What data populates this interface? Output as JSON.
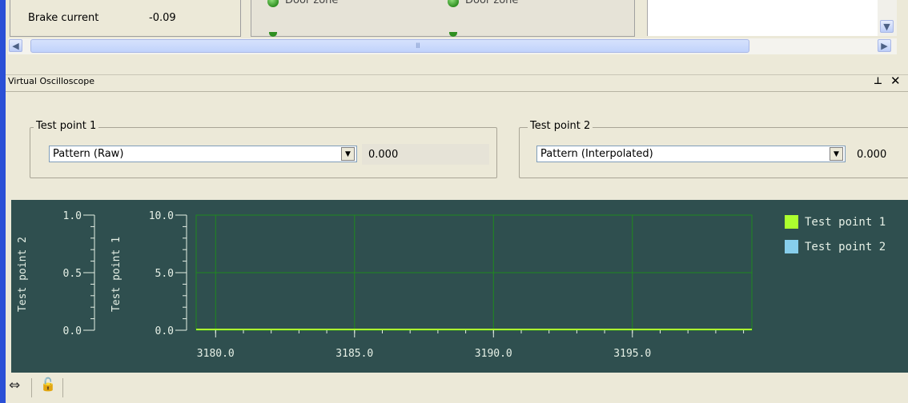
{
  "top": {
    "brake_label": "Brake current",
    "brake_value": "-0.09",
    "door_zone_1": "Door zone",
    "door_zone_2": "Door zone",
    "hscroll_grip": "III"
  },
  "oscilloscope": {
    "title": "Virtual Oscilloscope",
    "pin_icon": "⊥",
    "close_icon": "✕",
    "test_point_1": {
      "label": "Test point 1",
      "selected": "Pattern (Raw)",
      "value": "0.000"
    },
    "test_point_2": {
      "label": "Test point 2",
      "selected": "Pattern (Interpolated)",
      "value": "0.000"
    }
  },
  "colors": {
    "plot_bg": "#2f4f4f",
    "grid": "#1f8a1f",
    "series1": "#adff2f",
    "series2": "#87ceeb"
  },
  "chart_data": {
    "type": "line",
    "x_ticks": [
      "3180.0",
      "3185.0",
      "3190.0",
      "3195.0"
    ],
    "xlim": [
      3179.3,
      3199.3
    ],
    "axes": [
      {
        "title": "Test point 2",
        "ylim": [
          0,
          1
        ],
        "ticks": [
          "1.0",
          "0.5",
          "0.0"
        ]
      },
      {
        "title": "Test point 1",
        "ylim": [
          0,
          10
        ],
        "ticks": [
          "10.0",
          "5.0",
          "0.0"
        ]
      }
    ],
    "series": [
      {
        "name": "Test point 1",
        "x": [
          3179.3,
          3199.3
        ],
        "y": [
          0,
          0
        ]
      },
      {
        "name": "Test point 2",
        "x": [
          3179.3,
          3199.3
        ],
        "y": [
          0,
          0
        ]
      }
    ],
    "legend": [
      "Test point 1",
      "Test point 2"
    ],
    "grid": true,
    "legend_position": "right"
  },
  "toolbar": {
    "fit_icon": "↔",
    "lock_icon": "🔓"
  }
}
